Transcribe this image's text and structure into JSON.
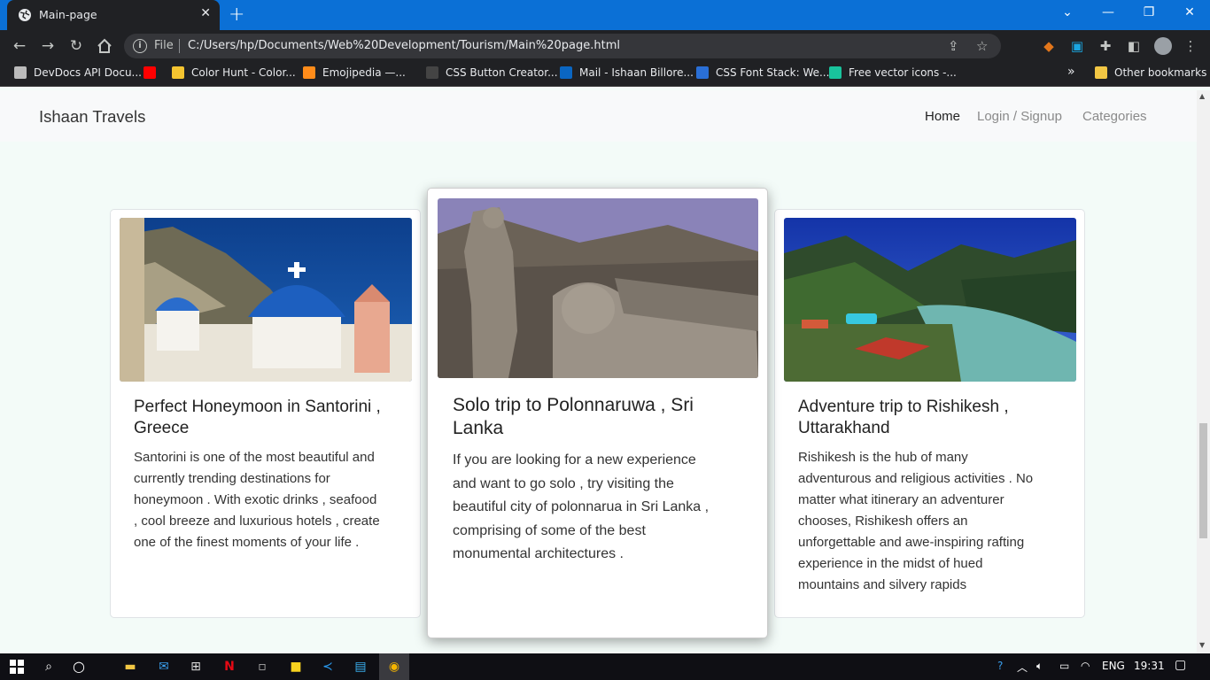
{
  "browser": {
    "tab_title": "Main-page",
    "file_label": "File",
    "url": "C:/Users/hp/Documents/Web%20Development/Tourism/Main%20page.html",
    "bookmarks": [
      {
        "label": "DevDocs API Docu...",
        "color": "#bbbbbb"
      },
      {
        "label": "",
        "color": "#ff0000"
      },
      {
        "label": "Color Hunt - Color...",
        "color": "#f4c430"
      },
      {
        "label": "Emojipedia —...",
        "color": "#ff8c1a"
      },
      {
        "label": "CSS Button Creator...",
        "color": "#444444"
      },
      {
        "label": "Mail - Ishaan Billore...",
        "color": "#0a66c2"
      },
      {
        "label": "CSS Font Stack: We...",
        "color": "#2a6fd6"
      },
      {
        "label": "Free vector icons -...",
        "color": "#19c39c"
      }
    ],
    "more_bookmarks": "»",
    "other_bookmarks": "Other bookmarks"
  },
  "navbar": {
    "brand": "Ishaan Travels",
    "links": [
      "Home",
      "Login / Signup",
      "Categories"
    ]
  },
  "cards": [
    {
      "title_lines": [
        "Perfect Honeymoon in Santorini ,",
        "Greece"
      ],
      "text_lines": [
        "Santorini is one of the most beautiful and",
        "currently trending destinations for",
        "honeymoon . With exotic drinks , seafood",
        ", cool breeze and luxurious hotels , create",
        "one of the finest moments of your life ."
      ]
    },
    {
      "title_lines": [
        "Solo trip to Polonnaruwa , Sri",
        "Lanka"
      ],
      "text_lines": [
        "If you are looking for a new experience",
        "and want to go solo , try visiting the",
        "beautiful city of polonnarua in Sri Lanka ,",
        "comprising of some of the best",
        "monumental architectures ."
      ]
    },
    {
      "title_lines": [
        "Adventure trip to Rishikesh ,",
        "Uttarakhand"
      ],
      "text_lines": [
        "Rishikesh is the hub of many",
        "adventurous and religious activities . No",
        "matter what itinerary an adventurer",
        "chooses, Rishikesh offers an",
        "unforgettable and awe-inspiring rafting",
        "experience in the midst of hued",
        "mountains and silvery rapids"
      ]
    }
  ],
  "taskbar": {
    "lang": "ENG",
    "time": "19:31"
  }
}
